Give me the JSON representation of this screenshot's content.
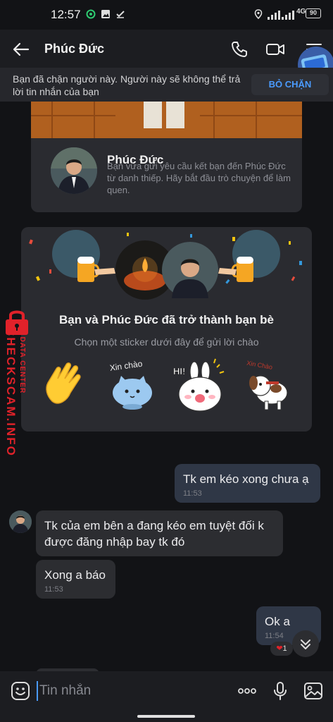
{
  "status_bar": {
    "time": "12:57",
    "network": "4G",
    "battery": "90",
    "icons": [
      "location-icon",
      "signal-icon",
      "signal-icon",
      "network-icon",
      "battery-icon",
      "app-icon",
      "image-icon",
      "check-icon"
    ]
  },
  "header": {
    "title": "Phúc Đức",
    "icons": [
      "back-arrow-icon",
      "phone-icon",
      "video-icon",
      "menu-icon"
    ]
  },
  "block_banner": {
    "text": "Bạn đã chặn người này. Người này sẽ không thể trả lời tin nhắn của bạn",
    "button": "BỎ CHẶN"
  },
  "profile_card": {
    "name": "Phúc Đức",
    "subtitle": "Bạn vừa gửi yêu cầu kết bạn đến Phúc Đức từ danh thiếp. Hãy bắt đầu trò chuyện để làm quen."
  },
  "friend_card": {
    "title": "Bạn và Phúc Đức đã trở thành bạn bè",
    "subtitle": "Chọn một sticker dưới đây để gửi lời chào",
    "stickers": [
      {
        "name": "wave-hand",
        "label": ""
      },
      {
        "name": "cat-xin-chao",
        "label": "Xin chào"
      },
      {
        "name": "bunny-hi",
        "label": "HI!"
      },
      {
        "name": "dog-xin-chao",
        "label": "Xin Chào"
      }
    ]
  },
  "watermark": {
    "brand": "CHECKSCAM.INFO",
    "sub": "DATA CENTER"
  },
  "messages": [
    {
      "side": "out",
      "text": "Tk em kéo xong chưa ạ",
      "time": "11:53"
    },
    {
      "side": "in",
      "text": "Tk của em bên a đang kéo em tuyệt đối k được đăng nhập bay tk đó",
      "time": ""
    },
    {
      "side": "in",
      "text": "Xong a báo",
      "time": "11:53"
    },
    {
      "side": "out",
      "text": "Ok a",
      "time": "11:54"
    }
  ],
  "reaction": {
    "emoji": "❤",
    "count": "1"
  },
  "input": {
    "placeholder": "Tin nhắn",
    "icons": [
      "emoji-icon",
      "more-icon",
      "microphone-icon",
      "image-icon"
    ]
  },
  "colors": {
    "background": "#121316",
    "bar": "#1c1d21",
    "accent": "#4a9bff",
    "outgoing_bubble": "#2f3746",
    "incoming_bubble": "#2c2d31",
    "watermark": "#e0222a"
  }
}
